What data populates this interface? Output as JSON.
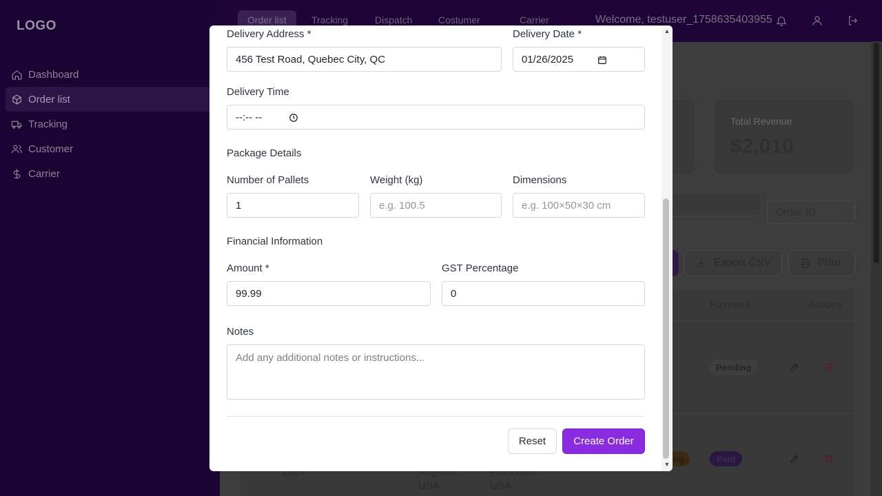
{
  "sidebar": {
    "logo": "LOGO",
    "items": [
      {
        "label": "Dashboard",
        "icon": "home-icon"
      },
      {
        "label": "Order list",
        "icon": "box-icon",
        "active": true
      },
      {
        "label": "Tracking",
        "icon": "truck-icon"
      },
      {
        "label": "Customer",
        "icon": "user-icon"
      },
      {
        "label": "Carrier",
        "icon": "dollar-icon"
      }
    ]
  },
  "topbar": {
    "tabs": [
      "Order list",
      "Tracking",
      "Dispatch",
      "Costumer",
      "Carrier"
    ],
    "welcome": "Welcome, testuser_1758635403955"
  },
  "background": {
    "stat_title": "Total Revenue",
    "stat_value": "$2,010",
    "filter_select": "Order ID",
    "export_label": "Export CSV",
    "print_label": "Print",
    "table_headers": {
      "payment": "Payment",
      "actions": "Actions"
    },
    "badges": {
      "pending": "Pending",
      "paid": "Paid",
      "partial": "ng"
    },
    "row2_date": "2024",
    "row2_from": "Angeles,\nUSA",
    "row2_to": "Francisco,\nUSA"
  },
  "modal": {
    "delivery_address_label": "Delivery Address *",
    "delivery_address_value": "456 Test Road, Quebec City, QC",
    "delivery_date_label": "Delivery Date *",
    "delivery_date_value": "01/26/2025",
    "delivery_time_label": "Delivery Time",
    "delivery_time_value": "--:-- --",
    "package_section": "Package Details",
    "pallets_label": "Number of Pallets",
    "pallets_value": "1",
    "weight_label": "Weight (kg)",
    "weight_placeholder": "e.g. 100.5",
    "dimensions_label": "Dimensions",
    "dimensions_placeholder": "e.g. 100×50×30 cm",
    "financial_section": "Financial Information",
    "amount_label": "Amount *",
    "amount_value": "99.99",
    "gst_label": "GST Percentage",
    "gst_value": "0",
    "notes_label": "Notes",
    "notes_placeholder": "Add any additional notes or instructions...",
    "reset_label": "Reset",
    "create_label": "Create Order"
  },
  "colors": {
    "sidebar_bg": "#1a0433",
    "accent": "#8a2be2"
  }
}
